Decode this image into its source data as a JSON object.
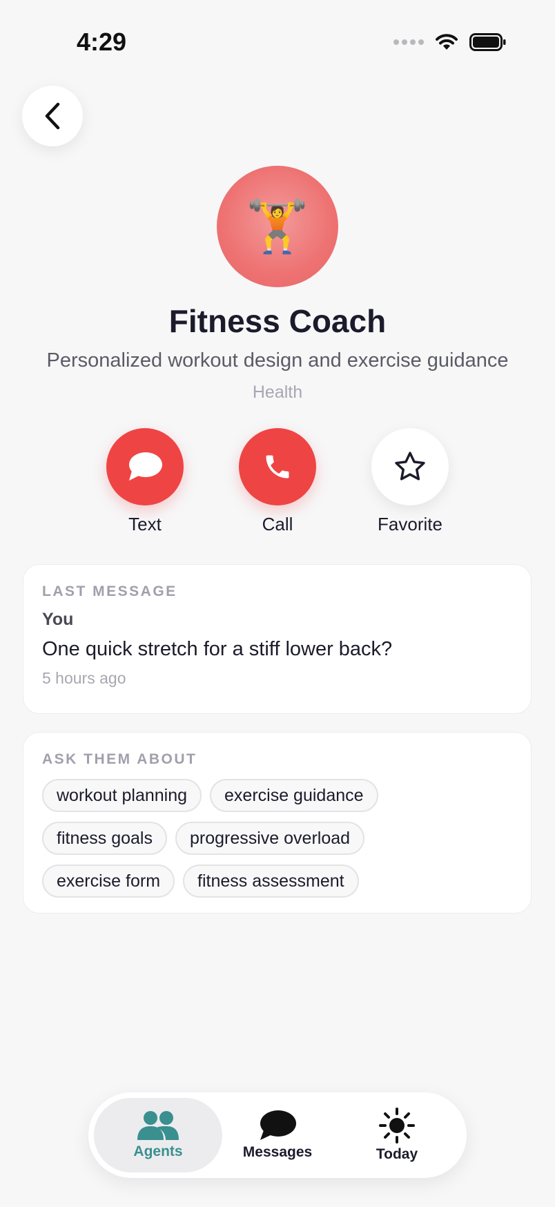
{
  "status": {
    "time": "4:29"
  },
  "agent": {
    "emoji": "🏋️",
    "name": "Fitness Coach",
    "description": "Personalized workout design and exercise guidance",
    "category": "Health"
  },
  "actions": {
    "text_label": "Text",
    "call_label": "Call",
    "favorite_label": "Favorite"
  },
  "last_message": {
    "section_label": "LAST MESSAGE",
    "from": "You",
    "text": "One quick stretch for a stiff lower back?",
    "time": "5 hours ago"
  },
  "ask": {
    "section_label": "ASK THEM ABOUT",
    "topics": [
      "workout planning",
      "exercise guidance",
      "fitness goals",
      "progressive overload",
      "exercise form",
      "fitness assessment"
    ]
  },
  "tabs": {
    "agents": "Agents",
    "messages": "Messages",
    "today": "Today"
  },
  "colors": {
    "accent_red": "#ef4444",
    "avatar": "#ee7272",
    "tab_active": "#3a8f8f"
  },
  "icons": {
    "back": "chevron-left-icon",
    "text": "chat-bubble-icon",
    "call": "phone-icon",
    "favorite": "star-icon",
    "agents": "people-icon",
    "messages": "speech-bubble-icon",
    "today": "sun-icon"
  }
}
